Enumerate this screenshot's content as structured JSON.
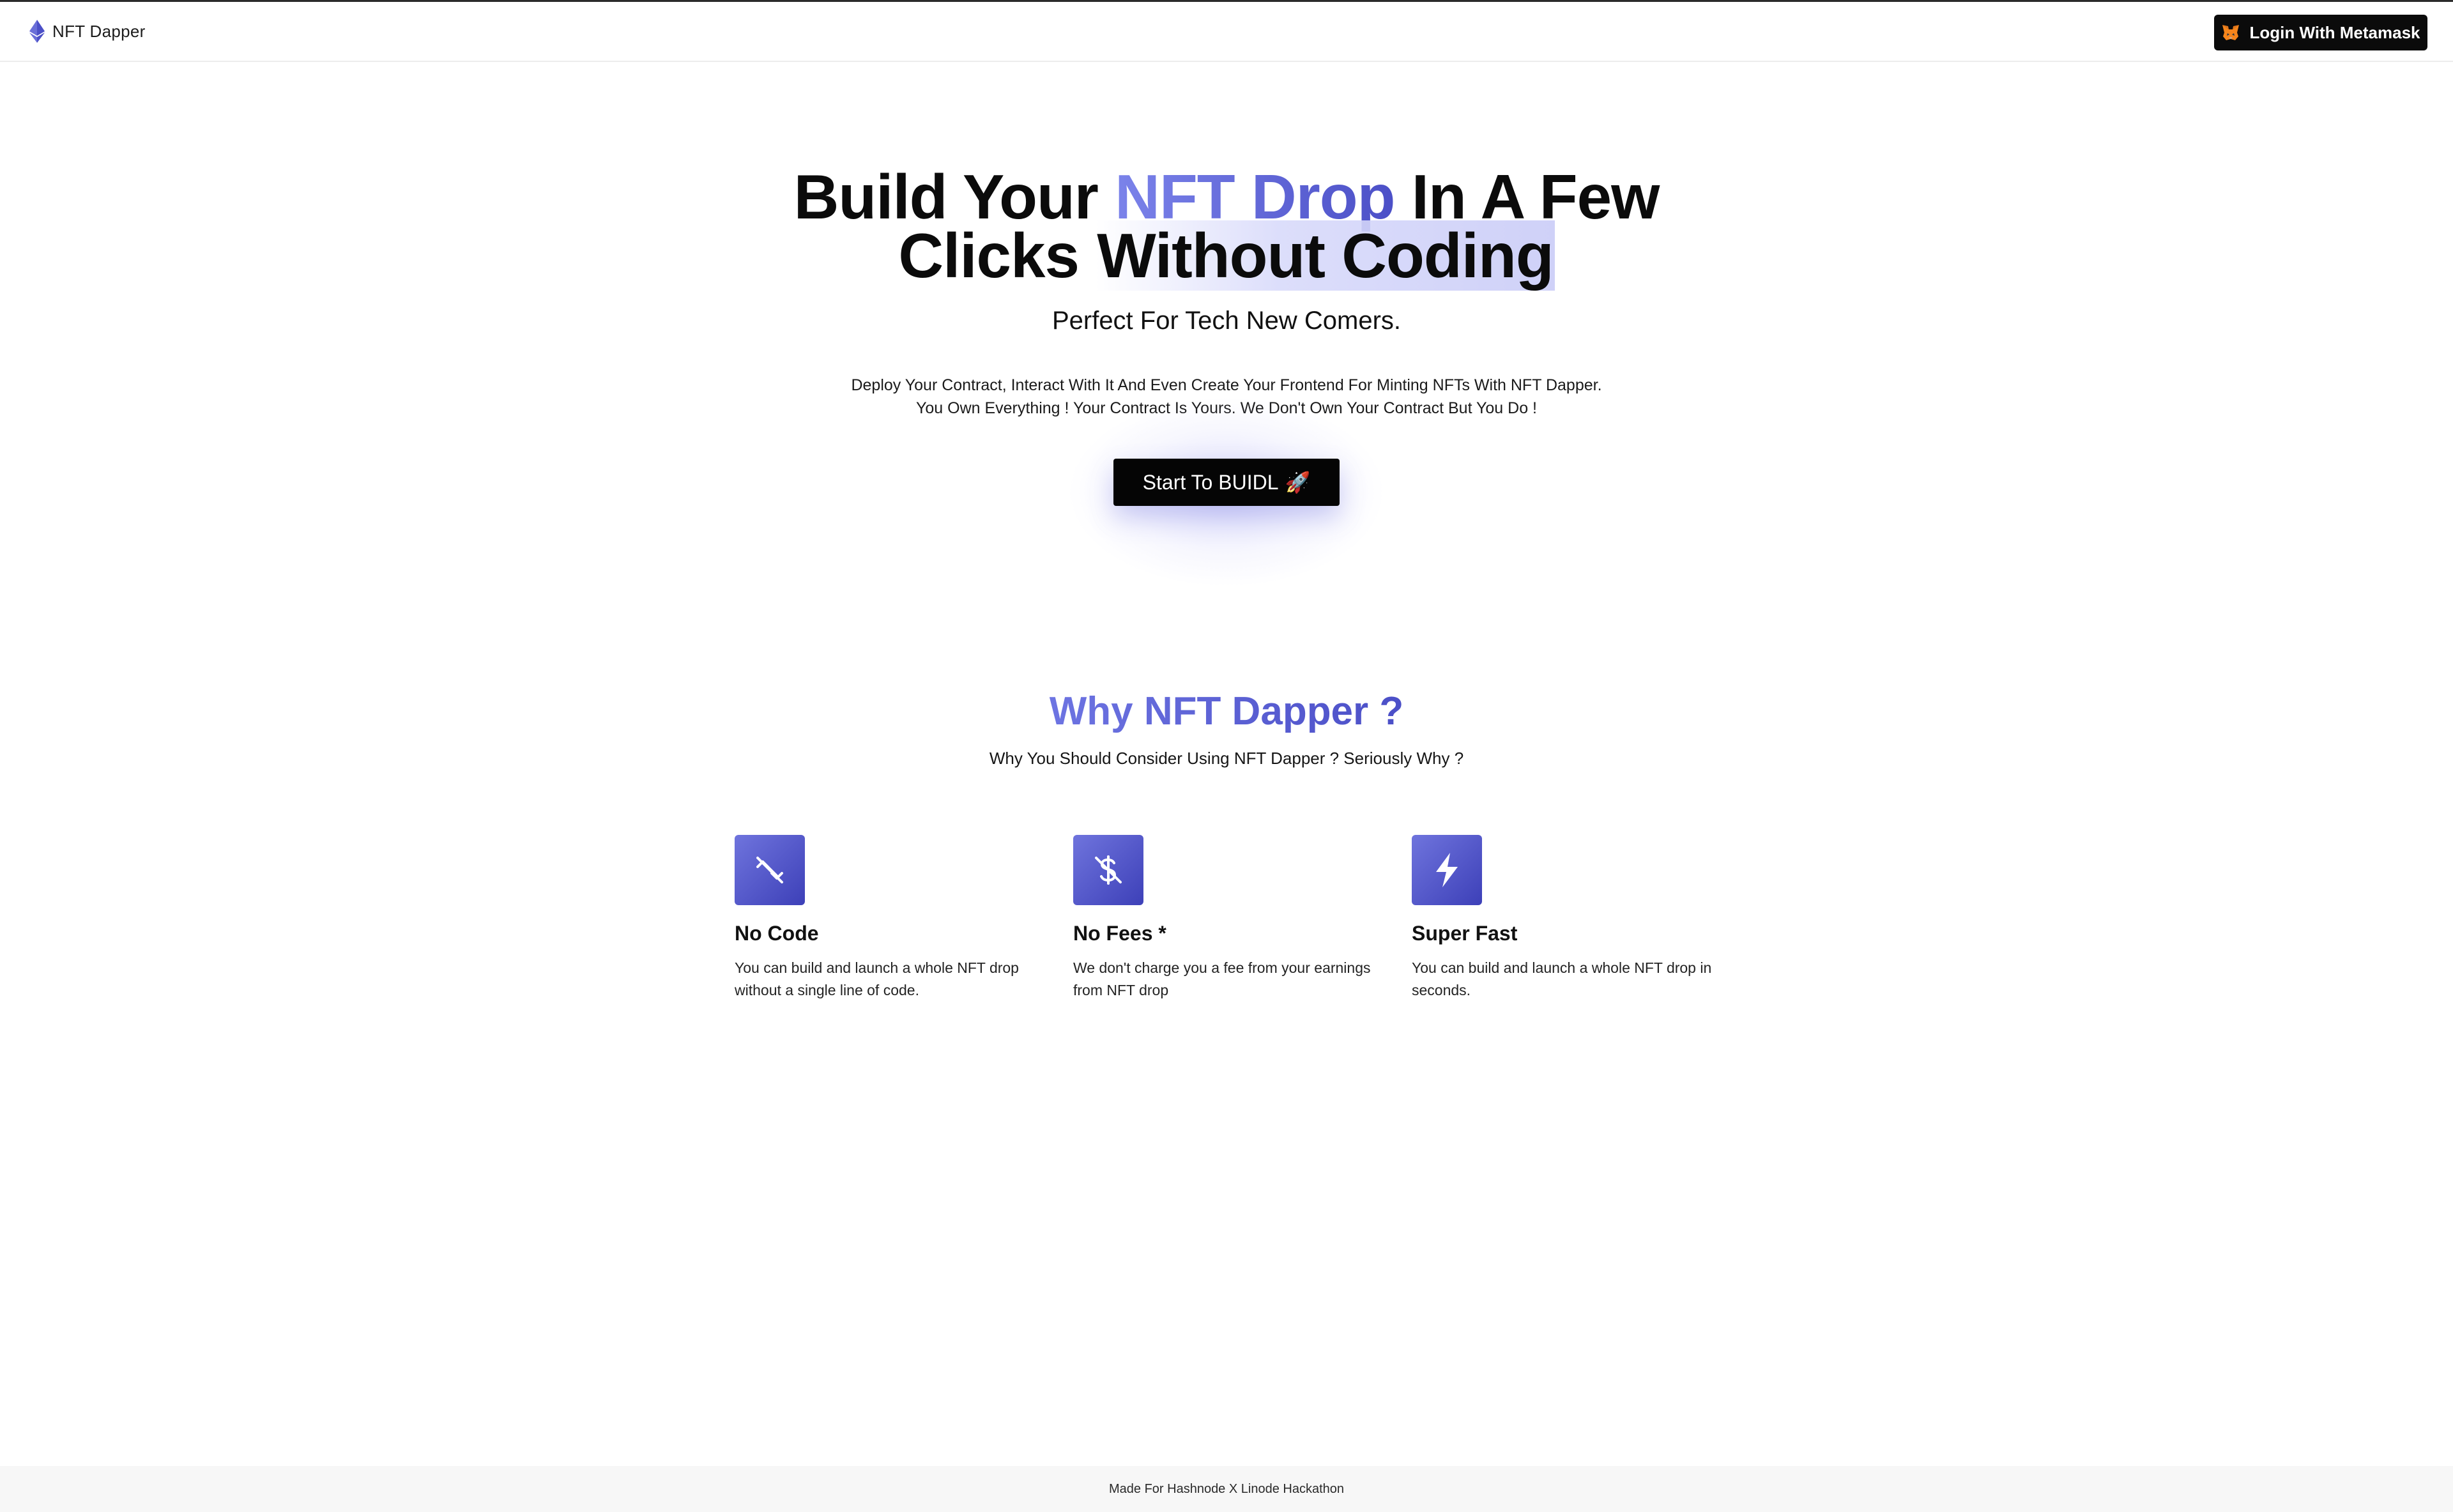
{
  "navbar": {
    "brand_name": "NFT Dapper",
    "brand_icon": "ethereum-icon",
    "login_label": "Login With Metamask",
    "login_icon": "metamask-fox-icon"
  },
  "hero": {
    "title_part1": "Build Your ",
    "title_accent": "NFT Drop",
    "title_part2": " In A Few",
    "title_part3": "Clicks ",
    "title_highlight": "Without Coding",
    "subtitle": "Perfect For Tech New Comers.",
    "desc_line1": "Deploy Your Contract, Interact With It And Even Create Your Frontend For Minting NFTs With NFT Dapper.",
    "desc_line2": "You Own Everything ! Your Contract Is Yours. We Don't Own Your Contract But You Do !",
    "cta_label": "Start To BUIDL",
    "cta_emoji": "🚀"
  },
  "why": {
    "title": "Why NFT Dapper ?",
    "subtitle": "Why You Should Consider Using NFT Dapper ? Seriously Why ?",
    "features": [
      {
        "icon": "no-code-icon",
        "title": "No Code",
        "description": "You can build and launch a whole NFT drop without a single line of code."
      },
      {
        "icon": "no-fees-icon",
        "title": "No Fees *",
        "description": "We don't charge you a fee from your earnings from NFT drop"
      },
      {
        "icon": "lightning-icon",
        "title": "Super Fast",
        "description": "You can build and launch a whole NFT drop in seconds."
      }
    ]
  },
  "footer": {
    "text": "Made For Hashnode X Linode Hackathon"
  },
  "colors": {
    "accent_start": "#7b83ea",
    "accent_end": "#4b4fc7",
    "button_bg": "#050505",
    "footer_bg": "#f7f7f7"
  }
}
